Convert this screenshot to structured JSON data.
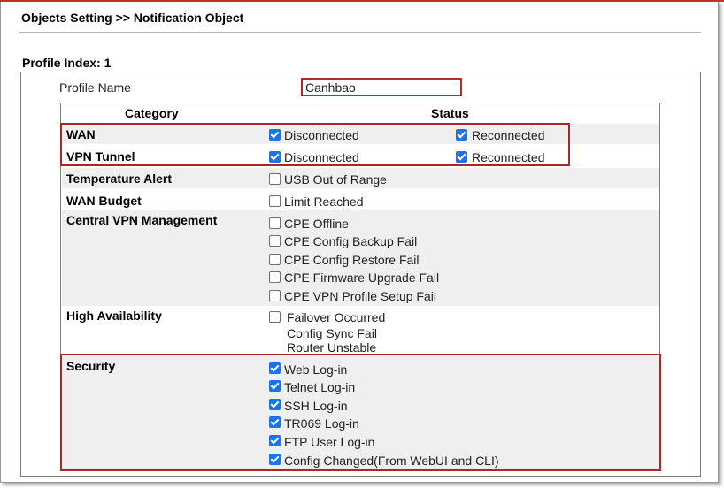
{
  "page": {
    "title": "Objects Setting >> Notification Object",
    "profile_index_label": "Profile Index: 1",
    "profile_name_label": "Profile Name",
    "profile_name_value": "Canhbao"
  },
  "table": {
    "col_category": "Category",
    "col_status": "Status"
  },
  "rows": {
    "wan": {
      "category": "WAN",
      "options": [
        {
          "label": "Disconnected",
          "checked": true
        },
        {
          "label": "Reconnected",
          "checked": true
        }
      ]
    },
    "vpn_tunnel": {
      "category": "VPN Tunnel",
      "options": [
        {
          "label": "Disconnected",
          "checked": true
        },
        {
          "label": "Reconnected",
          "checked": true
        }
      ]
    },
    "temperature_alert": {
      "category": "Temperature Alert",
      "options": [
        {
          "label": "USB Out of Range",
          "checked": false
        }
      ]
    },
    "wan_budget": {
      "category": "WAN Budget",
      "options": [
        {
          "label": "Limit Reached",
          "checked": false
        }
      ]
    },
    "central_vpn": {
      "category": "Central VPN Management",
      "options": [
        {
          "label": "CPE Offline",
          "checked": false
        },
        {
          "label": "CPE Config Backup Fail",
          "checked": false
        },
        {
          "label": "CPE Config Restore Fail",
          "checked": false
        },
        {
          "label": "CPE Firmware Upgrade Fail",
          "checked": false
        },
        {
          "label": "CPE VPN Profile Setup Fail",
          "checked": false
        }
      ]
    },
    "high_availability": {
      "category": "High Availability",
      "options": [
        {
          "label": "Failover Occurred",
          "checked": false
        },
        {
          "label": "Config Sync Fail"
        },
        {
          "label": "Router Unstable"
        }
      ]
    },
    "security": {
      "category": "Security",
      "options": [
        {
          "label": "Web Log-in",
          "checked": true
        },
        {
          "label": "Telnet Log-in",
          "checked": true
        },
        {
          "label": "SSH Log-in",
          "checked": true
        },
        {
          "label": "TR069 Log-in",
          "checked": true
        },
        {
          "label": "FTP User Log-in",
          "checked": true
        },
        {
          "label": "Config Changed(From WebUI and CLI)",
          "checked": true
        }
      ]
    }
  },
  "colors": {
    "accent_border": "#a62a2a",
    "checkbox_checked": "#1a73e8",
    "row_band": "#efefef"
  }
}
